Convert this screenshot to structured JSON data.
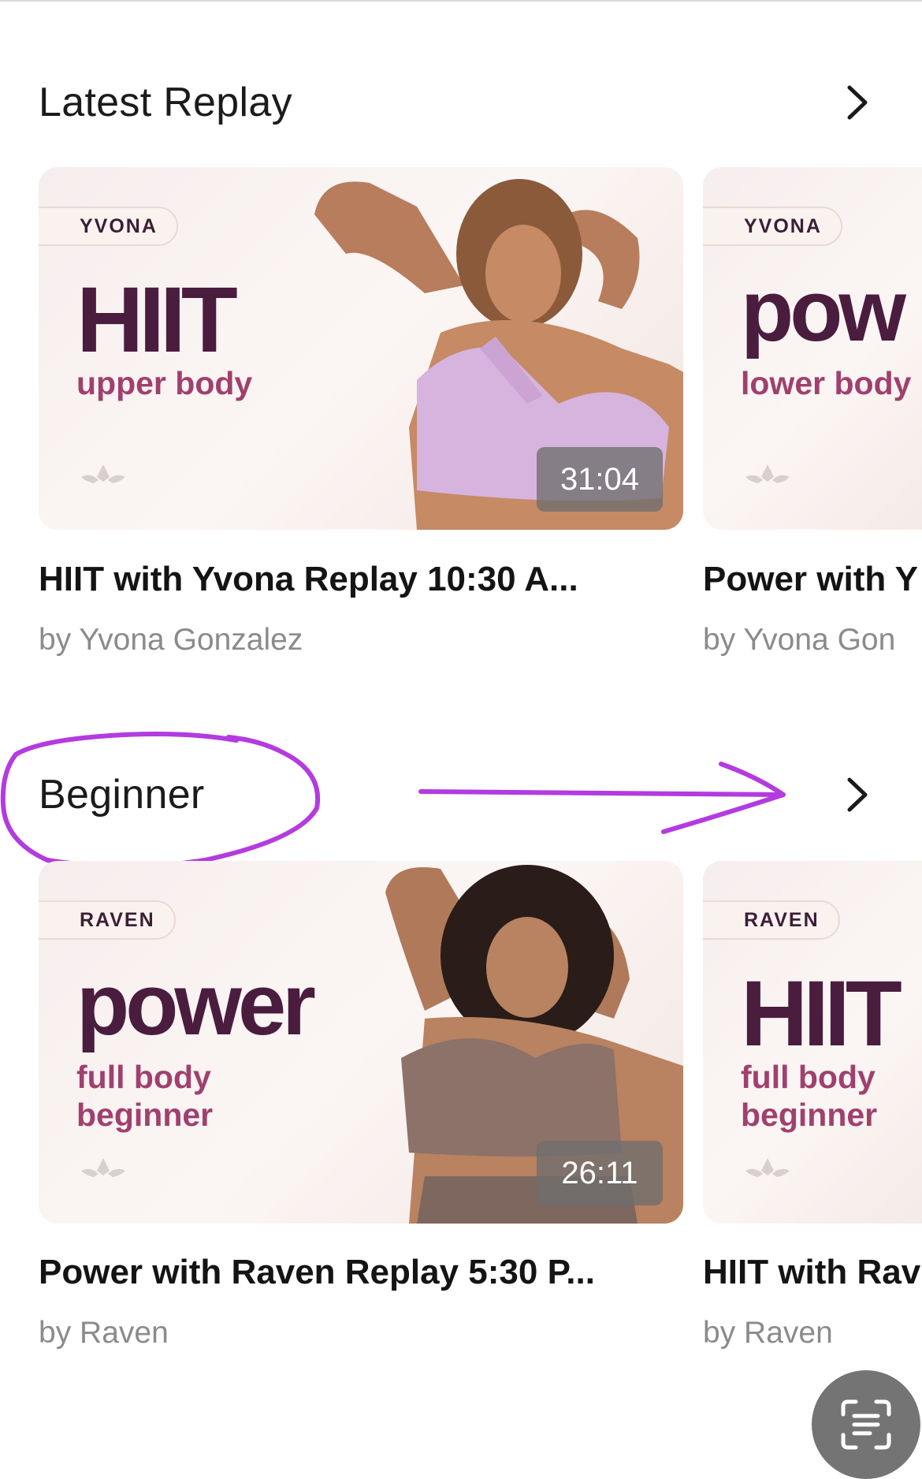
{
  "sections": [
    {
      "title": "Latest Replay",
      "cards": [
        {
          "instructor_tag": "YVONA",
          "headline": "HIIT",
          "subline": [
            "upper body"
          ],
          "duration": "31:04",
          "title": "HIIT with Yvona Replay 10:30 A...",
          "author": "by Yvona Gonzalez"
        },
        {
          "instructor_tag": "YVONA",
          "headline": "pow",
          "subline": [
            "lower body"
          ],
          "title": "Power with Y",
          "author": "by Yvona Gon"
        }
      ]
    },
    {
      "title": "Beginner",
      "cards": [
        {
          "instructor_tag": "RAVEN",
          "headline": "power",
          "subline": [
            "full body",
            "beginner"
          ],
          "duration": "26:11",
          "title": "Power with Raven Replay 5:30 P...",
          "author": "by Raven"
        },
        {
          "instructor_tag": "RAVEN",
          "headline": "HIIT",
          "subline": [
            "full body",
            "beginner"
          ],
          "title": "HIIT with Rav",
          "author": "by Raven"
        }
      ]
    }
  ],
  "icons": {
    "see_all": "chevron-right-icon",
    "scan": "scan-text-icon"
  },
  "colors": {
    "headline": "#4a1d3f",
    "subline": "#a0406e",
    "annotation": "#b33be0",
    "pill_bg": "#faf2ef"
  }
}
